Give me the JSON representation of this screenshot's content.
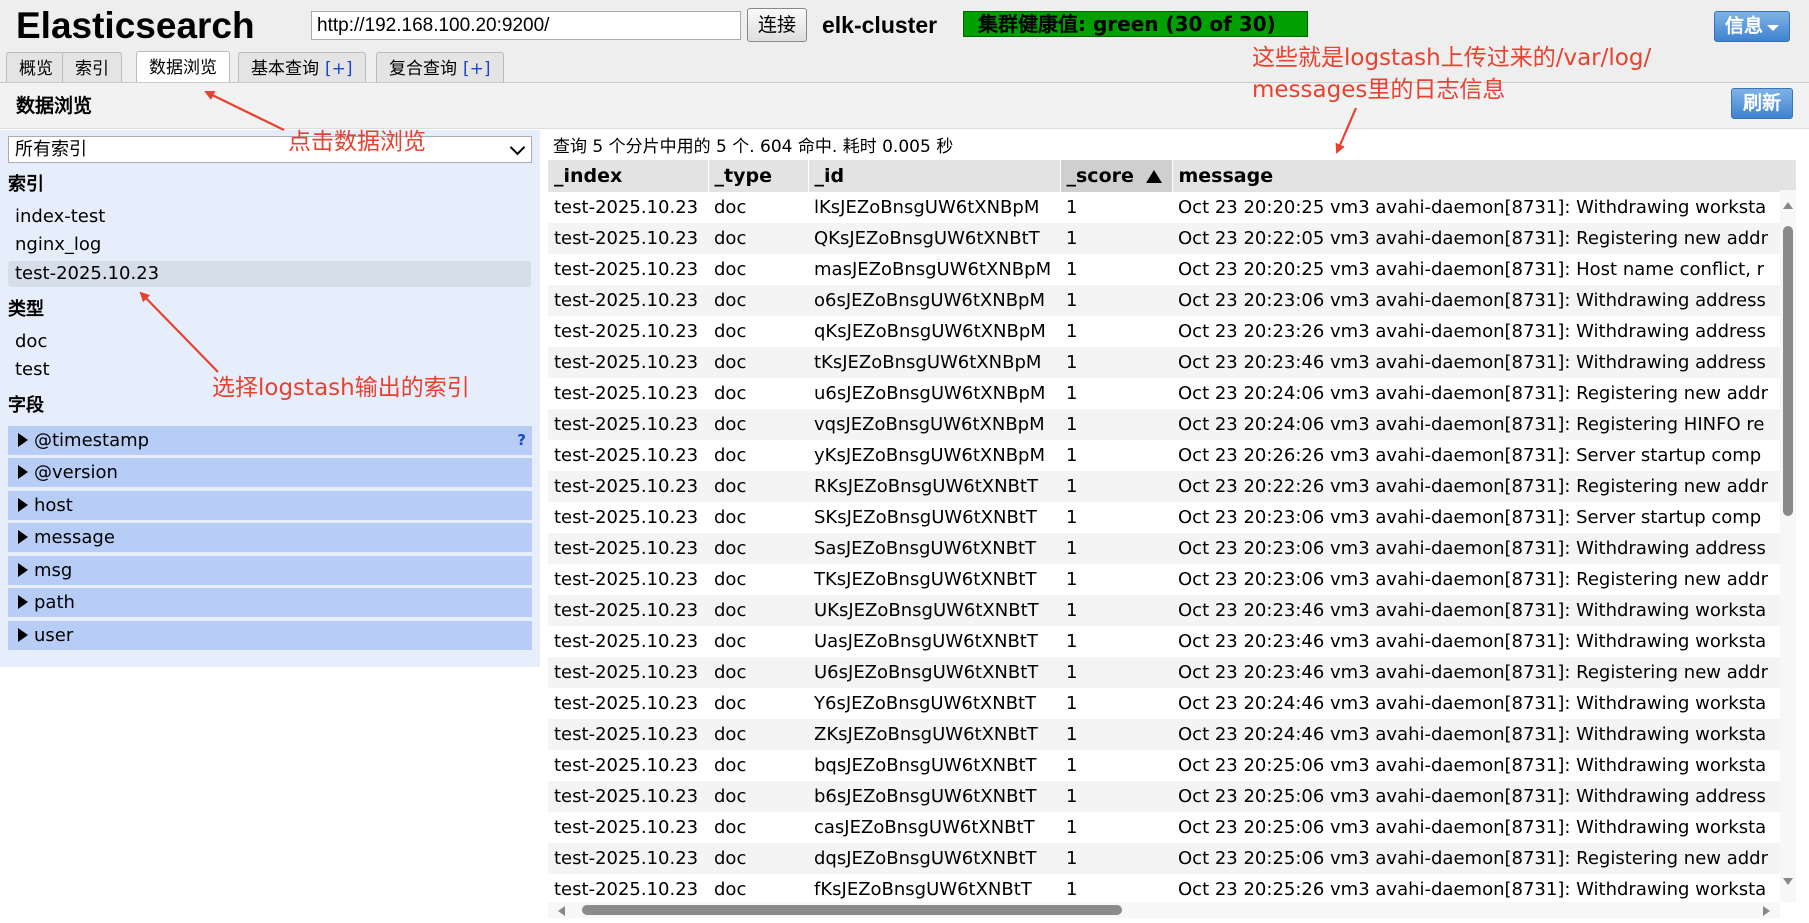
{
  "app": {
    "brand": "Elasticsearch",
    "url": "http://192.168.100.20:9200/",
    "connect_label": "连接",
    "cluster_name": "elk-cluster",
    "health_text": "集群健康值: green (30 of 30)",
    "health_color": "#00a000",
    "info_label": "信息"
  },
  "tabs": [
    {
      "label": "概览"
    },
    {
      "label": "索引"
    },
    {
      "label": "数据浏览",
      "active": true
    },
    {
      "label": "基本查询",
      "plus": "[+]"
    },
    {
      "label": "复合查询",
      "plus": "[+]"
    }
  ],
  "page": {
    "title": "数据浏览",
    "refresh_label": "刷新"
  },
  "sidebar": {
    "index_select_value": "所有索引",
    "indices_heading": "索引",
    "indices": [
      "index-test",
      "nginx_log",
      "test-2025.10.23"
    ],
    "types_heading": "类型",
    "types": [
      "doc",
      "test"
    ],
    "fields_heading": "字段",
    "fields": [
      "@timestamp",
      "@version",
      "host",
      "message",
      "msg",
      "path",
      "user"
    ],
    "help_mark": "?"
  },
  "results": {
    "summary": "查询 5 个分片中用的 5 个. 604 命中. 耗时 0.005 秒",
    "columns": [
      "_index",
      "_type",
      "_id",
      "_score",
      "message"
    ],
    "rows": [
      [
        "test-2025.10.23",
        "doc",
        "lKsJEZoBnsgUW6tXNBpM",
        "1",
        "Oct 23 20:20:25 vm3 avahi-daemon[8731]: Withdrawing worksta"
      ],
      [
        "test-2025.10.23",
        "doc",
        "QKsJEZoBnsgUW6tXNBtT",
        "1",
        "Oct 23 20:22:05 vm3 avahi-daemon[8731]: Registering new addr"
      ],
      [
        "test-2025.10.23",
        "doc",
        "masJEZoBnsgUW6tXNBpM",
        "1",
        "Oct 23 20:20:25 vm3 avahi-daemon[8731]: Host name conflict, r"
      ],
      [
        "test-2025.10.23",
        "doc",
        "o6sJEZoBnsgUW6tXNBpM",
        "1",
        "Oct 23 20:23:06 vm3 avahi-daemon[8731]: Withdrawing address"
      ],
      [
        "test-2025.10.23",
        "doc",
        "qKsJEZoBnsgUW6tXNBpM",
        "1",
        "Oct 23 20:23:26 vm3 avahi-daemon[8731]: Withdrawing address"
      ],
      [
        "test-2025.10.23",
        "doc",
        "tKsJEZoBnsgUW6tXNBpM",
        "1",
        "Oct 23 20:23:46 vm3 avahi-daemon[8731]: Withdrawing address"
      ],
      [
        "test-2025.10.23",
        "doc",
        "u6sJEZoBnsgUW6tXNBpM",
        "1",
        "Oct 23 20:24:06 vm3 avahi-daemon[8731]: Registering new addr"
      ],
      [
        "test-2025.10.23",
        "doc",
        "vqsJEZoBnsgUW6tXNBpM",
        "1",
        "Oct 23 20:24:06 vm3 avahi-daemon[8731]: Registering HINFO re"
      ],
      [
        "test-2025.10.23",
        "doc",
        "yKsJEZoBnsgUW6tXNBpM",
        "1",
        "Oct 23 20:26:26 vm3 avahi-daemon[8731]: Server startup comp"
      ],
      [
        "test-2025.10.23",
        "doc",
        "RKsJEZoBnsgUW6tXNBtT",
        "1",
        "Oct 23 20:22:26 vm3 avahi-daemon[8731]: Registering new addr"
      ],
      [
        "test-2025.10.23",
        "doc",
        "SKsJEZoBnsgUW6tXNBtT",
        "1",
        "Oct 23 20:23:06 vm3 avahi-daemon[8731]: Server startup comp"
      ],
      [
        "test-2025.10.23",
        "doc",
        "SasJEZoBnsgUW6tXNBtT",
        "1",
        "Oct 23 20:23:06 vm3 avahi-daemon[8731]: Withdrawing address"
      ],
      [
        "test-2025.10.23",
        "doc",
        "TKsJEZoBnsgUW6tXNBtT",
        "1",
        "Oct 23 20:23:06 vm3 avahi-daemon[8731]: Registering new addr"
      ],
      [
        "test-2025.10.23",
        "doc",
        "UKsJEZoBnsgUW6tXNBtT",
        "1",
        "Oct 23 20:23:46 vm3 avahi-daemon[8731]: Withdrawing worksta"
      ],
      [
        "test-2025.10.23",
        "doc",
        "UasJEZoBnsgUW6tXNBtT",
        "1",
        "Oct 23 20:23:46 vm3 avahi-daemon[8731]: Withdrawing worksta"
      ],
      [
        "test-2025.10.23",
        "doc",
        "U6sJEZoBnsgUW6tXNBtT",
        "1",
        "Oct 23 20:23:46 vm3 avahi-daemon[8731]: Registering new addr"
      ],
      [
        "test-2025.10.23",
        "doc",
        "Y6sJEZoBnsgUW6tXNBtT",
        "1",
        "Oct 23 20:24:46 vm3 avahi-daemon[8731]: Withdrawing worksta"
      ],
      [
        "test-2025.10.23",
        "doc",
        "ZKsJEZoBnsgUW6tXNBtT",
        "1",
        "Oct 23 20:24:46 vm3 avahi-daemon[8731]: Withdrawing worksta"
      ],
      [
        "test-2025.10.23",
        "doc",
        "bqsJEZoBnsgUW6tXNBtT",
        "1",
        "Oct 23 20:25:06 vm3 avahi-daemon[8731]: Withdrawing worksta"
      ],
      [
        "test-2025.10.23",
        "doc",
        "b6sJEZoBnsgUW6tXNBtT",
        "1",
        "Oct 23 20:25:06 vm3 avahi-daemon[8731]: Withdrawing address"
      ],
      [
        "test-2025.10.23",
        "doc",
        "casJEZoBnsgUW6tXNBtT",
        "1",
        "Oct 23 20:25:06 vm3 avahi-daemon[8731]: Withdrawing worksta"
      ],
      [
        "test-2025.10.23",
        "doc",
        "dqsJEZoBnsgUW6tXNBtT",
        "1",
        "Oct 23 20:25:06 vm3 avahi-daemon[8731]: Registering new addr"
      ],
      [
        "test-2025.10.23",
        "doc",
        "fKsJEZoBnsgUW6tXNBtT",
        "1",
        "Oct 23 20:25:26 vm3 avahi-daemon[8731]: Withdrawing worksta"
      ]
    ]
  },
  "annotations": {
    "click_browse": "点击数据浏览",
    "select_index": "选择logstash输出的索引",
    "messages_line1": "这些就是logstash上传过来的/var/log/",
    "messages_line2": "messages里的日志信息",
    "color": "#e8422f"
  }
}
